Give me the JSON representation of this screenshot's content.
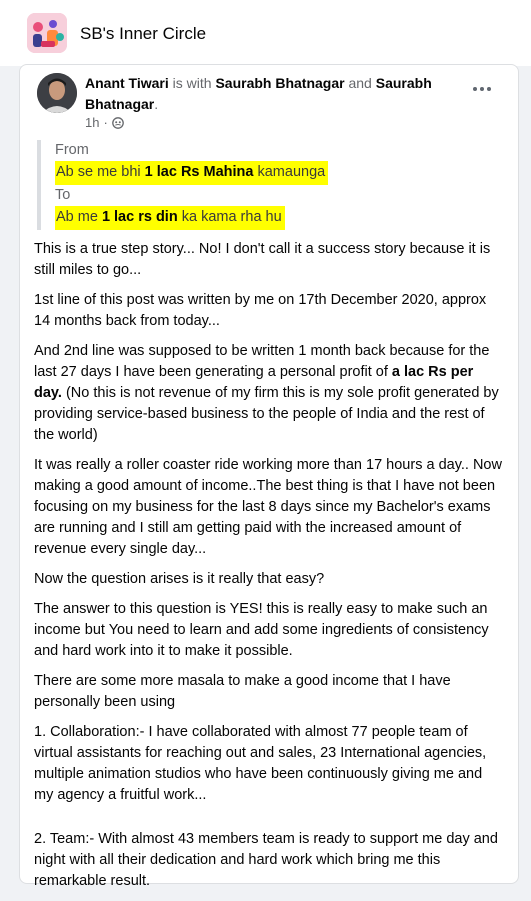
{
  "group": {
    "name": "SB's Inner Circle"
  },
  "post": {
    "author": "Anant Tiwari",
    "with_text": "is with",
    "tagged_1": "Saurabh Bhatnagar",
    "and_text": "and",
    "tagged_2": "Saurabh Bhatnagar",
    "period": ".",
    "time": "1h",
    "audience_separator": "·",
    "quote": {
      "from_label": "From",
      "from_pre": "Ab se me bhi ",
      "from_bold": "1 lac Rs Mahina",
      "from_post": " kamaunga",
      "to_label": "To",
      "to_pre": "Ab me ",
      "to_bold": "1 lac rs din",
      "to_post": " ka kama rha hu"
    },
    "paragraphs": {
      "p1": "This is a true step story... No! I don't call it a success story because it is still miles to go...",
      "p2": "1st line of this post was written by me on 17th December 2020, approx 14 months back from today...",
      "p3_pre": "And 2nd line was supposed to be written 1 month back because for the last 27 days I have been generating a personal profit of ",
      "p3_bold": "a lac Rs per day.",
      "p3_post": " (No this is not revenue of my firm this is my sole profit generated by providing service-based business to the people of India and the rest of the world)",
      "p4": "It was really a roller coaster ride working more than 17 hours a day.. Now making a good amount of income..The best thing is that I have not been focusing on my business for the last 8 days since my Bachelor's exams are running and I still am getting paid with the increased amount of revenue every single day...",
      "p5": "Now the question arises is it really that easy?",
      "p6": "The answer to this question is YES! this is really easy to make such an income but You need to learn and add some ingredients of consistency and hard work into it to make it possible.",
      "p7": "There are some more masala to make a good income that I have personally been using",
      "p8": "1. Collaboration:- I have collaborated with almost 77 people team of virtual assistants for reaching out and sales, 23 International agencies, multiple animation studios who have been continuously giving me and my agency a fruitful work...",
      "p9": "2. Team:- With almost 43 members team is ready to support me day and night with all their dedication and hard work which bring me this remarkable result."
    }
  }
}
